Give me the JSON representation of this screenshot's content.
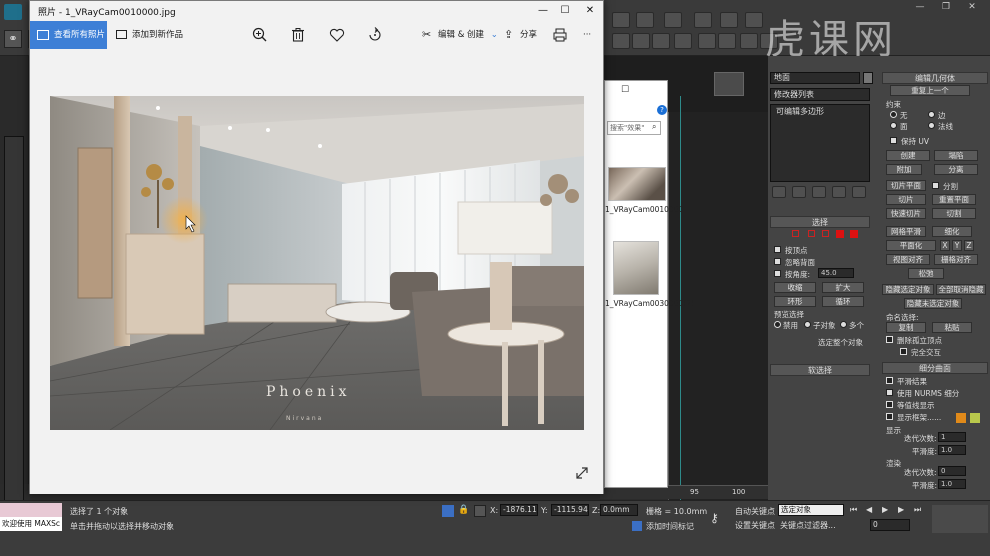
{
  "photos": {
    "title": "照片 - 1_VRayCam0010000.jpg",
    "see_all": "查看所有照片",
    "add_to": "添加到新作品",
    "edit_create": "编辑 & 创建",
    "share": "分享",
    "more": "···",
    "watermark_main": "Phoenix",
    "watermark_sub": "Nirvana"
  },
  "explorer": {
    "search_placeholder": "搜索\"效果\"",
    "files": [
      {
        "name": "1_VRayCam0010000"
      },
      {
        "name": "1_VRayCam0030000(2)"
      }
    ]
  },
  "brand": {
    "logo_text": "虎课网"
  },
  "max": {
    "object_name": "地面",
    "modifier_list": "修改器列表",
    "modifier_item": "可编辑多边形",
    "edit_geometry": {
      "title": "编辑几何体",
      "repeat_last": "重复上一个",
      "constraints": "约束",
      "c_none": "无",
      "c_edge": "边",
      "c_face": "面",
      "c_normal": "法线",
      "preserve_uv": "保持 UV",
      "create": "创建",
      "collapse": "塌陷",
      "attach": "附加",
      "detach": "分离",
      "slice_plane": "切片平面",
      "split": "分割",
      "slice": "切片",
      "reset_plane": "重置平面",
      "quickslice": "快速切片",
      "cut": "切割",
      "meshsmooth": "网格平滑",
      "tessellate": "细化",
      "planarize": "平面化",
      "x": "X",
      "y": "Y",
      "z": "Z",
      "view_align": "视图对齐",
      "grid_align": "栅格对齐",
      "relax": "松弛",
      "hide_selected": "隐藏选定对象",
      "unhide_all": "全部取消隐藏",
      "hide_unselected": "隐藏未选定对象",
      "named_sel": "命名选择:",
      "copy": "复制",
      "paste": "粘贴",
      "delete_iso": "删除孤立顶点",
      "full_interact": "完全交互"
    },
    "selection": {
      "title": "选择",
      "by_vertex": "按顶点",
      "ignore_back": "忽略背面",
      "by_angle": "按角度:",
      "angle": "45.0",
      "shrink": "收缩",
      "grow": "扩大",
      "ring": "环形",
      "loop": "循环",
      "preview": "预览选择",
      "disabled": "禁用",
      "subobj": "子对象",
      "multi": "多个",
      "whole_obj": "选定整个对象"
    },
    "soft_selection": "软选择",
    "subdivision": {
      "title": "细分曲面",
      "smooth_result": "平滑结果",
      "use_nurms": "使用 NURMS 细分",
      "isoline": "等值线显示",
      "show_cage": "显示框架......",
      "display": "显示",
      "iterations": "迭代次数:",
      "iter_val": "1",
      "smoothness": "平滑度:",
      "smooth_val": "1.0",
      "render": "渲染",
      "iter_val2": "0",
      "smooth_val2": "1.0"
    },
    "status": {
      "welcome": "欢迎使用 MAXSc",
      "selected": "选择了 1 个对象",
      "prompt": "单击并拖动以选择并移动对象",
      "x_label": "X:",
      "x": "-1876.116",
      "y_label": "Y:",
      "y": "-1115.942",
      "z_label": "Z:",
      "z": "0.0mm",
      "grid": "栅格 = 10.0mm",
      "add_time_tag": "添加时间标记",
      "auto_key": "自动关键点",
      "set_key": "设置关键点",
      "selected_obj": "选定对象",
      "key_filters": "关键点过滤器...",
      "frame": "0",
      "ruler_95": "95",
      "ruler_100": "100",
      "viewport_label": "[+]"
    }
  }
}
